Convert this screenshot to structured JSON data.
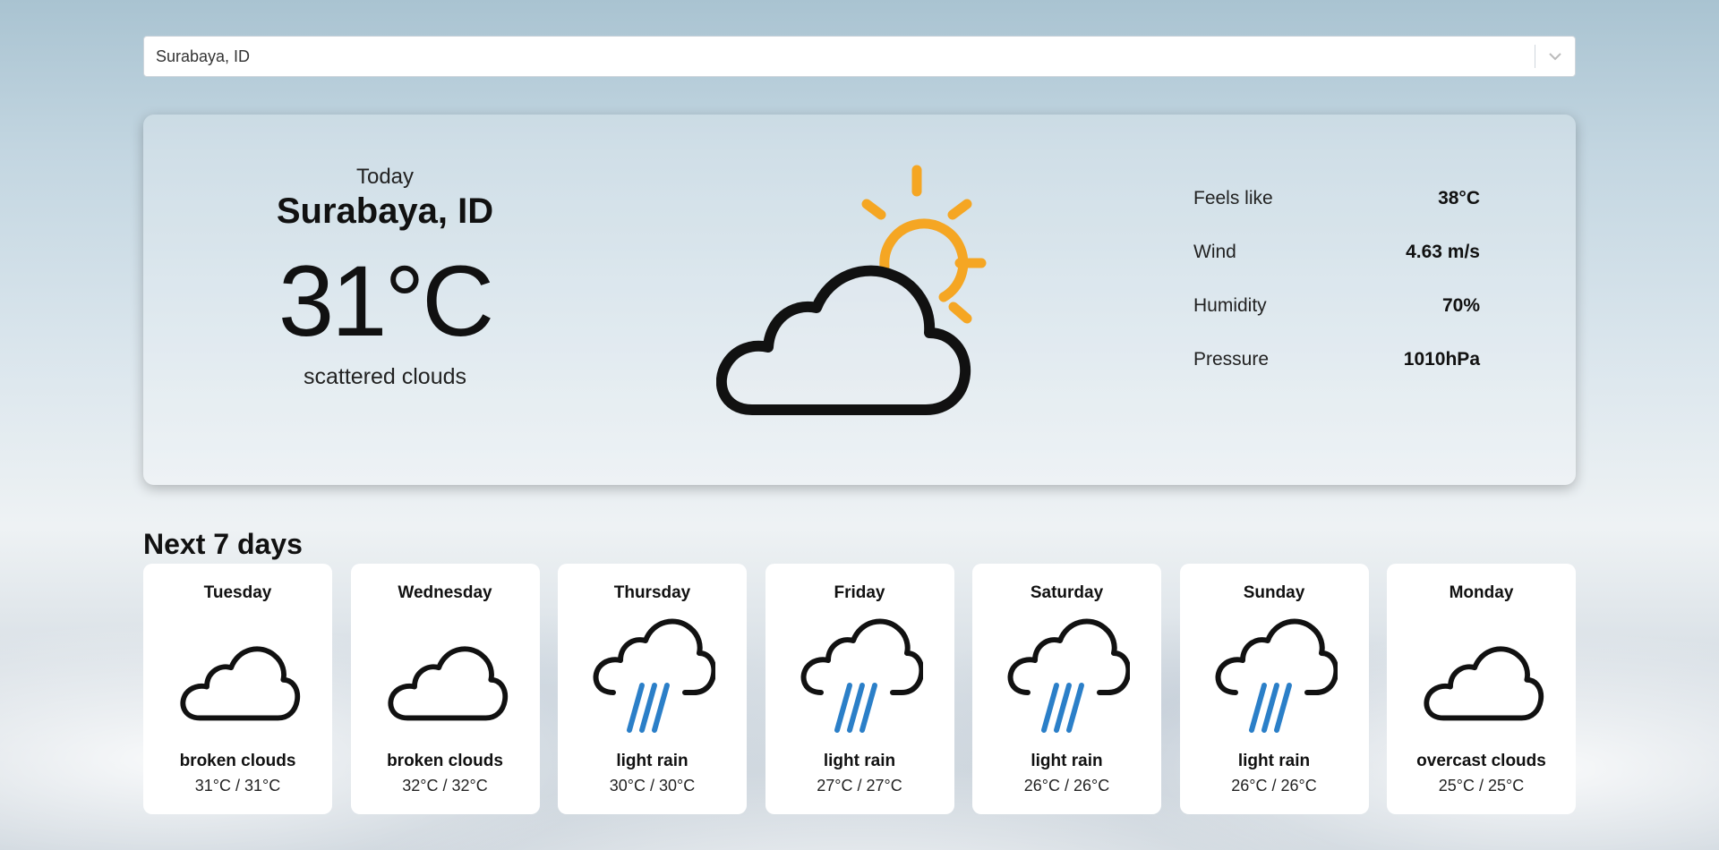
{
  "search": {
    "value": "Surabaya, ID",
    "icon": "chevron-down-icon"
  },
  "current": {
    "day_label": "Today",
    "city": "Surabaya, ID",
    "temperature": "31°C",
    "description": "scattered clouds",
    "icon": "partly-cloudy-icon",
    "details": [
      {
        "label": "Feels like",
        "value": "38°C"
      },
      {
        "label": "Wind",
        "value": "4.63 m/s"
      },
      {
        "label": "Humidity",
        "value": "70%"
      },
      {
        "label": "Pressure",
        "value": "1010hPa"
      }
    ]
  },
  "forecast": {
    "title": "Next 7 days",
    "days": [
      {
        "day": "Tuesday",
        "icon": "cloud-icon",
        "description": "broken clouds",
        "range": "31°C / 31°C"
      },
      {
        "day": "Wednesday",
        "icon": "cloud-icon",
        "description": "broken clouds",
        "range": "32°C / 32°C"
      },
      {
        "day": "Thursday",
        "icon": "rain-icon",
        "description": "light rain",
        "range": "30°C / 30°C"
      },
      {
        "day": "Friday",
        "icon": "rain-icon",
        "description": "light rain",
        "range": "27°C / 27°C"
      },
      {
        "day": "Saturday",
        "icon": "rain-icon",
        "description": "light rain",
        "range": "26°C / 26°C"
      },
      {
        "day": "Sunday",
        "icon": "rain-icon",
        "description": "light rain",
        "range": "26°C / 26°C"
      },
      {
        "day": "Monday",
        "icon": "cloud-icon",
        "description": "overcast clouds",
        "range": "25°C / 25°C"
      }
    ]
  },
  "colors": {
    "sun": "#f5a623",
    "rain": "#2b7fc8",
    "outline": "#111111"
  }
}
